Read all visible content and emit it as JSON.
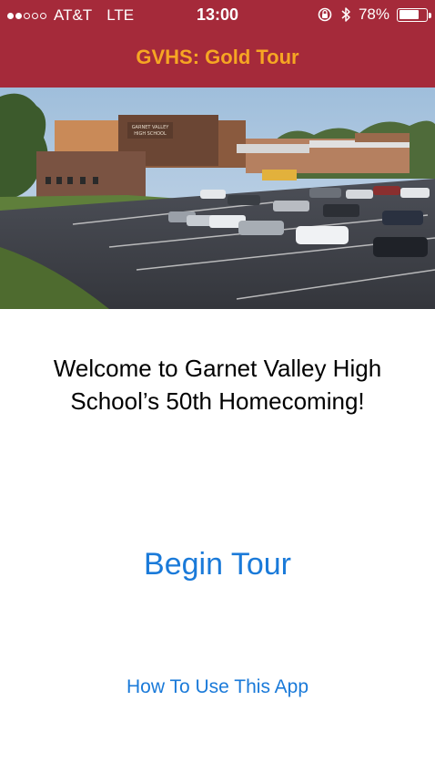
{
  "status_bar": {
    "carrier": "AT&T",
    "network": "LTE",
    "time": "13:00",
    "battery_percent": "78%",
    "battery_level": 0.78,
    "signal_bars_filled": 2,
    "signal_bars_total": 5
  },
  "nav": {
    "title": "GVHS: Gold Tour",
    "bar_color": "#a52a3a",
    "title_color": "#f6a623"
  },
  "hero": {
    "sign_text_line1": "GARNET VALLEY",
    "sign_text_line2": "HIGH SCHOOL"
  },
  "main": {
    "welcome_text": "Welcome to Garnet Valley High School’s 50th Homecoming!",
    "begin_label": "Begin Tour",
    "howto_label": "How To Use This App",
    "link_color": "#1a7ad9"
  }
}
